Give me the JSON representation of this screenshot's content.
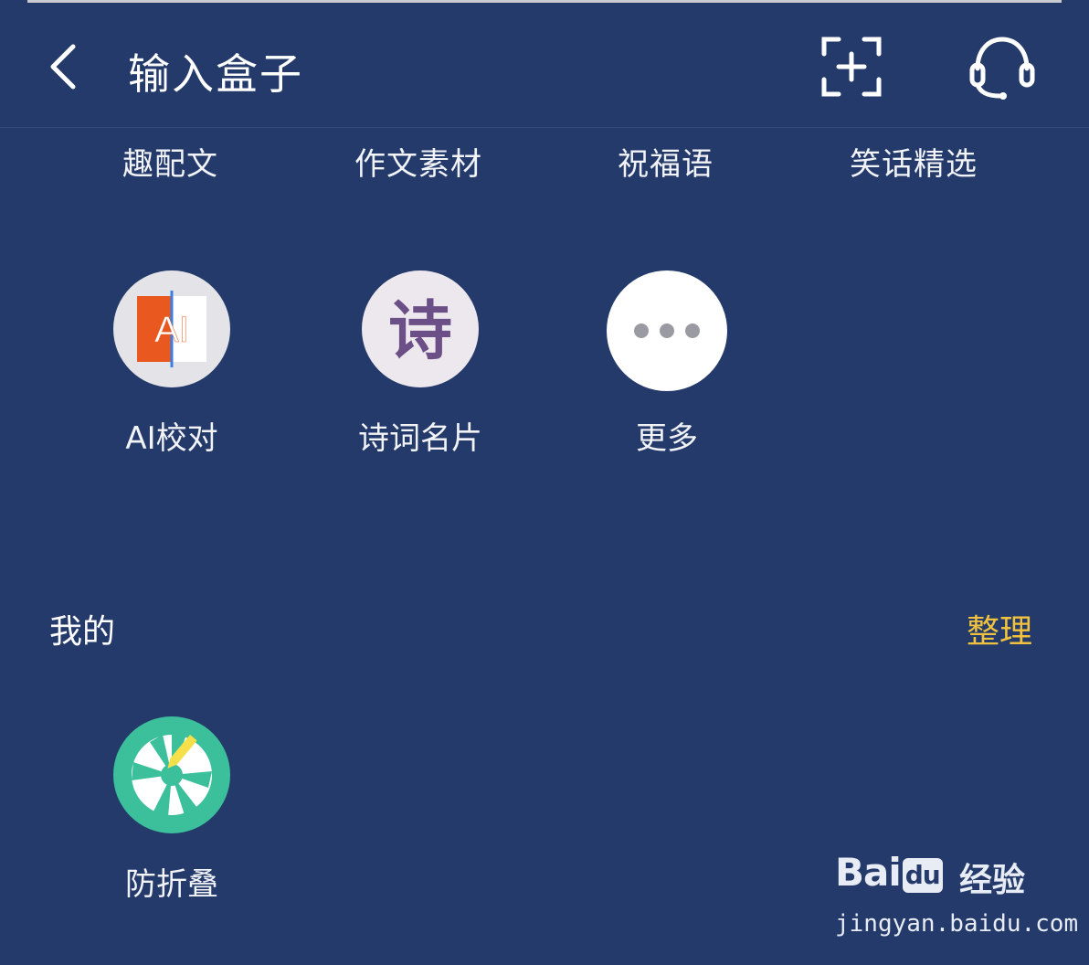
{
  "header": {
    "back_icon": "chevron-left-icon",
    "title": "输入盒子",
    "scan_icon": "scan-plus-icon",
    "support_icon": "headset-icon"
  },
  "categories": [
    "趣配文",
    "作文素材",
    "祝福语",
    "笑话精选"
  ],
  "tools": [
    {
      "label": "AI校对",
      "icon": "ai-proofread-icon",
      "icon_text": "AI"
    },
    {
      "label": "诗词名片",
      "icon": "poem-card-icon",
      "icon_text": "诗"
    },
    {
      "label": "更多",
      "icon": "more-dots-icon"
    }
  ],
  "mine": {
    "title": "我的",
    "action": "整理",
    "items": [
      {
        "label": "防折叠",
        "icon": "anti-fold-icon"
      }
    ]
  },
  "watermark": {
    "brand_left": "Bai",
    "brand_mid": "du",
    "brand_right": "经验",
    "url": "jingyan.baidu.com"
  },
  "colors": {
    "background": "#243a6b",
    "accent": "#f0c23e",
    "anti_fold_green": "#3cbf9b",
    "poem_purple": "#6b4f86"
  }
}
